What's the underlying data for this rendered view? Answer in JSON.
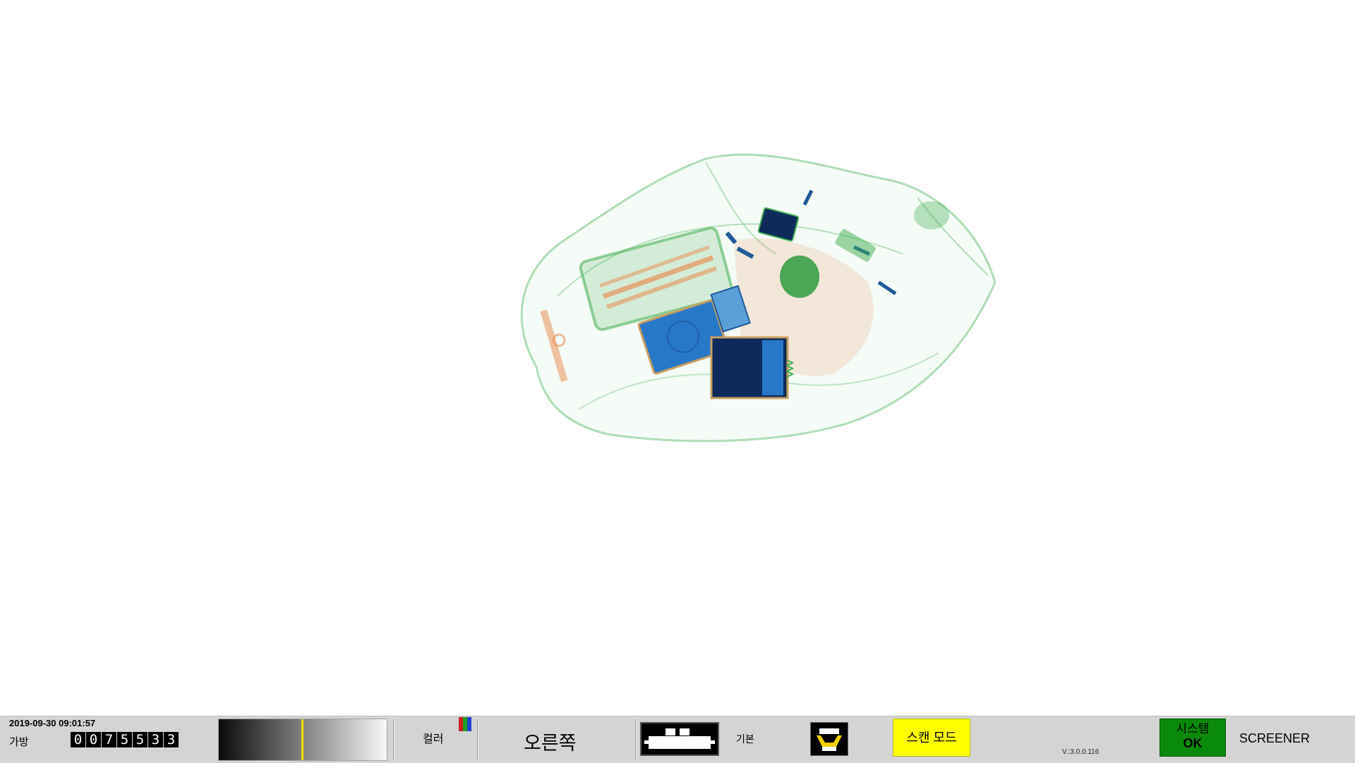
{
  "status_bar": {
    "datetime": "2019-09-30 09:01:57",
    "bag_label": "가방",
    "bag_count_digits": [
      "0",
      "0",
      "7",
      "5",
      "5",
      "3",
      "3"
    ],
    "color_label": "컬러",
    "color_icon_colors": [
      "#d02020",
      "#20a020",
      "#2040d0"
    ],
    "direction_label": "오른쪽",
    "mode_label": "기본",
    "scan_mode_label": "스캔 모드",
    "version": "V.:3.0.0.116",
    "system_status_line1": "시스템",
    "system_status_line2": "OK",
    "role_label": "SCREENER"
  },
  "colors": {
    "gradient_marker": "#f0e000",
    "scan_mode_bg": "#ffff00",
    "system_ok_bg": "#0a8a0a",
    "organic": "#e8925a",
    "inorganic": "#3fae4f",
    "metal": "#1e5a9a"
  },
  "icons": {
    "conveyor": "conveyor-belt-icon",
    "save": "save-image-icon",
    "color": "rgb-color-icon"
  }
}
